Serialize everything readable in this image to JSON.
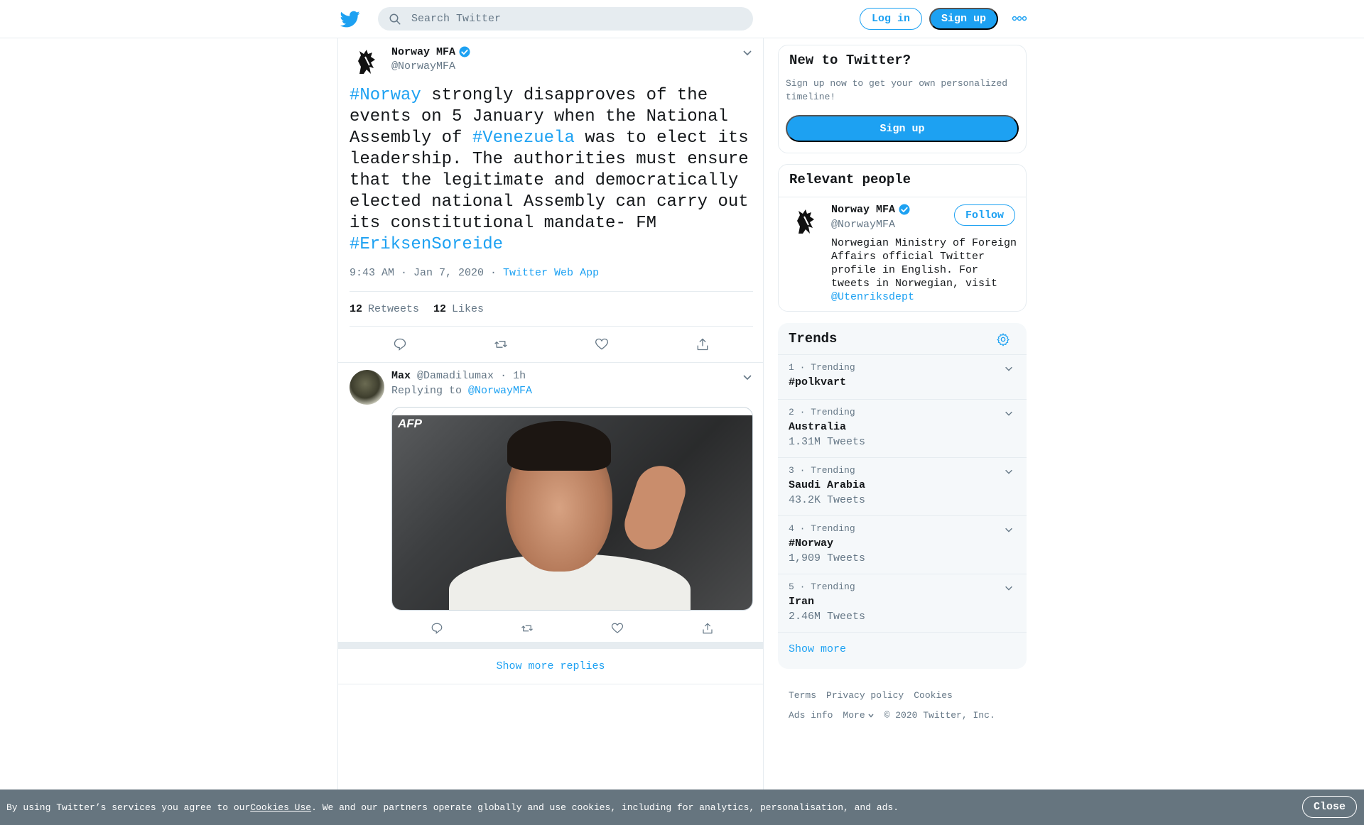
{
  "search": {
    "placeholder": "Search Twitter"
  },
  "topbar": {
    "login_label": "Log in",
    "signup_label": "Sign up"
  },
  "tweet": {
    "display_name": "Norway MFA",
    "handle": "@NorwayMFA",
    "text_parts": [
      {
        "text": "#Norway",
        "link": true
      },
      {
        "text": " strongly disapproves of the events on 5 January when the National Assembly of ",
        "link": false
      },
      {
        "text": "#Venezuela",
        "link": true
      },
      {
        "text": " was to elect its leadership. The authorities must ensure that the legitimate and democratically elected national Assembly can carry out its constitutional mandate- FM ",
        "link": false
      },
      {
        "text": "#EriksenSoreide",
        "link": true
      }
    ],
    "timestamp": "9:43 AM · Jan 7, 2020",
    "dot": " · ",
    "source": "Twitter Web App",
    "retweets": "12",
    "retweets_label": "Retweets",
    "likes": "12",
    "likes_label": "Likes"
  },
  "reply": {
    "display_name": "Max",
    "handle": "@Damadilumax",
    "age": "· 1h",
    "replying_prefix": "Replying to ",
    "replying_to": "@NorwayMFA",
    "media_watermark": "AFP"
  },
  "show_more_replies": "Show more replies",
  "new_to_twitter": {
    "title": "New to Twitter?",
    "text": "Sign up now to get your own personalized timeline!",
    "button": "Sign up"
  },
  "relevant_people": {
    "title": "Relevant people",
    "name": "Norway MFA",
    "handle": "@NorwayMFA",
    "follow_label": "Follow",
    "bio": "Norwegian Ministry of Foreign Affairs official Twitter profile in English. For tweets in Norwegian, visit ",
    "bio_link": "@Utenriksdept"
  },
  "trends": {
    "title": "Trends",
    "items": [
      {
        "meta": "1 · Trending",
        "name": "#polkvart",
        "count": ""
      },
      {
        "meta": "2 · Trending",
        "name": "Australia",
        "count": "1.31M Tweets"
      },
      {
        "meta": "3 · Trending",
        "name": "Saudi Arabia",
        "count": "43.2K Tweets"
      },
      {
        "meta": "4 · Trending",
        "name": "#Norway",
        "count": "1,909 Tweets"
      },
      {
        "meta": "5 · Trending",
        "name": "Iran",
        "count": "2.46M Tweets"
      }
    ],
    "show_more": "Show more"
  },
  "footer": {
    "terms": "Terms",
    "privacy": "Privacy policy",
    "cookies": "Cookies",
    "ads_info": "Ads info",
    "more": "More",
    "copyright": "© 2020 Twitter, Inc."
  },
  "cookie_bar": {
    "prefix": "By using Twitter’s services you agree to our ",
    "link": "Cookies Use",
    "suffix": ". We and our partners operate globally and use cookies, including for analytics, personalisation, and ads.",
    "close_label": "Close"
  },
  "colors": {
    "brand_blue": "#1da1f2",
    "text": "#14171a",
    "muted": "#657786",
    "border": "#e6ecf0",
    "cookie_bg": "#66757f"
  }
}
